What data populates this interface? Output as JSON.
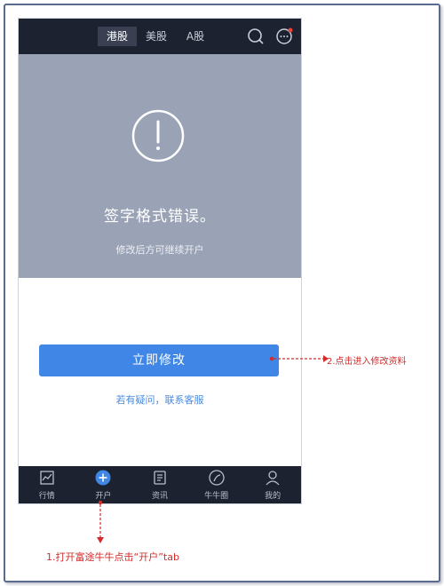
{
  "header": {
    "segments": [
      {
        "label": "港股",
        "active": true
      },
      {
        "label": "美股",
        "active": false
      },
      {
        "label": "A股",
        "active": false
      }
    ],
    "icons": [
      "search-icon",
      "message-icon"
    ],
    "notification_dot_color": "#e8443a"
  },
  "error": {
    "icon": "exclamation-circle-icon",
    "title": "签字格式错误。",
    "subtitle": "修改后方可继续开户"
  },
  "actions": {
    "primary_label": "立即修改",
    "help_text": "若有疑问，联系客服"
  },
  "tabbar": {
    "items": [
      {
        "label": "行情",
        "icon": "chart-icon"
      },
      {
        "label": "开户",
        "icon": "plus-circle-icon",
        "accent": "#3f86e6"
      },
      {
        "label": "资讯",
        "icon": "news-icon"
      },
      {
        "label": "牛牛圈",
        "icon": "circle-icon"
      },
      {
        "label": "我的",
        "icon": "user-icon"
      }
    ]
  },
  "annotations": {
    "step2": "2.点击进入修改资料",
    "step1": "1.打开富途牛牛点击“开户”tab",
    "color": "#d42a2a"
  }
}
